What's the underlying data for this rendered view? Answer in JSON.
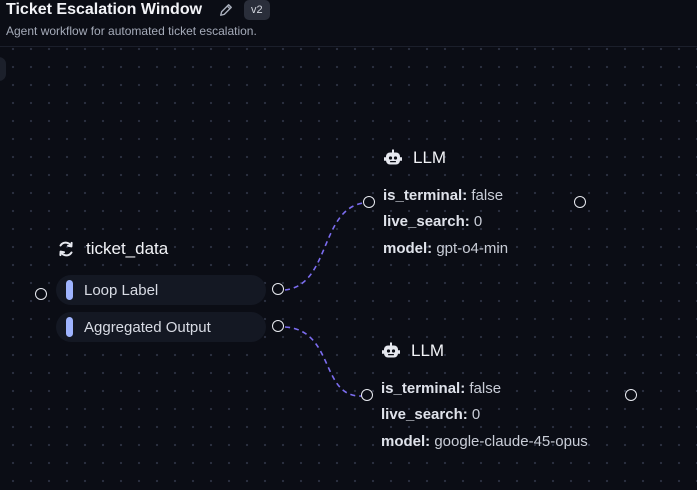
{
  "header": {
    "title": "Ticket Escalation Window",
    "version": "v2",
    "subtitle": "Agent workflow for automated ticket escalation."
  },
  "nodes": {
    "ticket_data": {
      "title": "ticket_data",
      "icon": "refresh-icon",
      "ports": [
        "Loop Label",
        "Aggregated Output"
      ]
    },
    "llm_1": {
      "title": "LLM",
      "icon": "robot-icon",
      "props": [
        {
          "key": "is_terminal:",
          "value": "false"
        },
        {
          "key": "live_search:",
          "value": "0"
        },
        {
          "key": "model:",
          "value": "gpt-o4-min"
        }
      ]
    },
    "llm_2": {
      "title": "LLM",
      "icon": "robot-icon",
      "props": [
        {
          "key": "is_terminal:",
          "value": "false"
        },
        {
          "key": "live_search:",
          "value": "0"
        },
        {
          "key": "model:",
          "value": "google-claude-45-opus"
        }
      ]
    }
  },
  "colors": {
    "canvas": "#0b0d15",
    "wire": "#7c6df0",
    "port_bar": "#9fb4ff"
  }
}
